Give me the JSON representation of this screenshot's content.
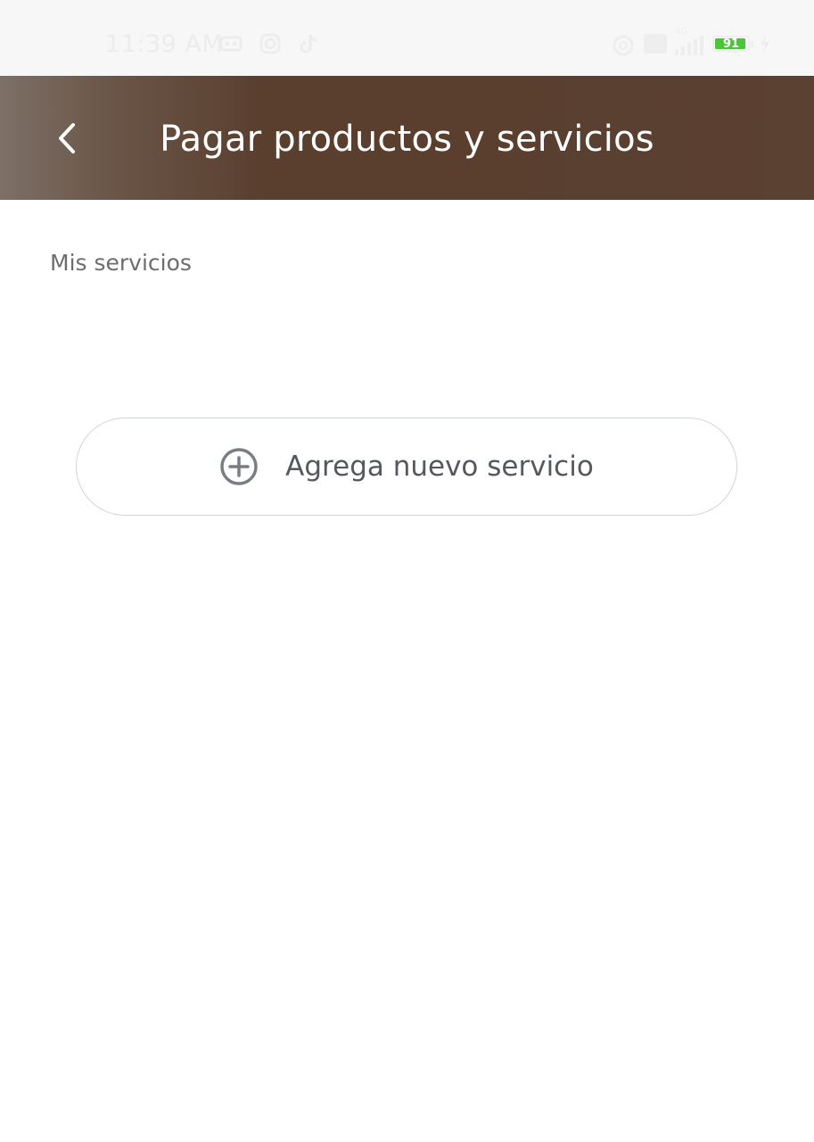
{
  "status_bar": {
    "time": "11:39 AM",
    "battery_level": "91",
    "network_label": "4G",
    "left_icons": [
      "notification-icon",
      "instagram-icon",
      "tiktok-icon"
    ],
    "right_icons": [
      "alarm-icon",
      "hd-icon",
      "signal-icon",
      "battery-icon",
      "charging-icon"
    ]
  },
  "header": {
    "title": "Pagar productos y servicios",
    "back_icon": "chevron-left-icon",
    "background_color": "#5a3f2f"
  },
  "main": {
    "section_label": "Mis servicios",
    "add_button": {
      "label": "Agrega nuevo servicio",
      "icon": "plus-circle-icon"
    }
  }
}
